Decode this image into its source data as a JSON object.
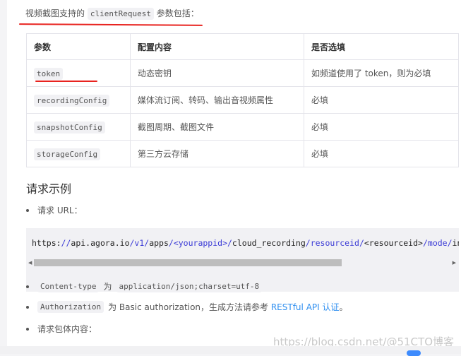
{
  "intro": {
    "prefix": "视频截图支持的",
    "code": "clientRequest",
    "suffix": "参数包括："
  },
  "table": {
    "headers": [
      "参数",
      "配置内容",
      "是否选填"
    ],
    "rows": [
      {
        "param": "token",
        "desc": "动态密钥",
        "required": "如频道使用了 token，则为必填"
      },
      {
        "param": "recordingConfig",
        "desc": "媒体流订阅、转码、输出音视频属性",
        "required": "必填"
      },
      {
        "param": "snapshotConfig",
        "desc": "截图周期、截图文件",
        "required": "必填"
      },
      {
        "param": "storageConfig",
        "desc": "第三方云存储",
        "required": "必填"
      }
    ]
  },
  "section_title": "请求示例",
  "bullets": {
    "url_label": "请求 URL：",
    "content_type": {
      "code": "Content-type",
      "mid": "为",
      "value": "application/json;charset=utf-8"
    },
    "authorization": {
      "code": "Authorization",
      "text": "为 Basic authorization，生成方法请参考",
      "link": "RESTful API 认证",
      "end": "。"
    },
    "body_label": "请求包体内容："
  },
  "code_url": [
    {
      "t": "https:",
      "k": false
    },
    {
      "t": "//",
      "k": true
    },
    {
      "t": "api.agora.io",
      "k": false
    },
    {
      "t": "/v1/",
      "k": true
    },
    {
      "t": "apps",
      "k": false
    },
    {
      "t": "/<yourappid>/",
      "k": true
    },
    {
      "t": "cloud_recording",
      "k": false
    },
    {
      "t": "/resourceid/",
      "k": true
    },
    {
      "t": "<resourceid>",
      "k": false
    },
    {
      "t": "/mode/",
      "k": true
    },
    {
      "t": "individual",
      "k": false
    }
  ],
  "watermark": "https://blog.csdn.net/@51CTO博客",
  "colors": {
    "annotation": "#e8231f",
    "link": "#2f8ff0",
    "code_keyword": "#3b3bd6"
  }
}
